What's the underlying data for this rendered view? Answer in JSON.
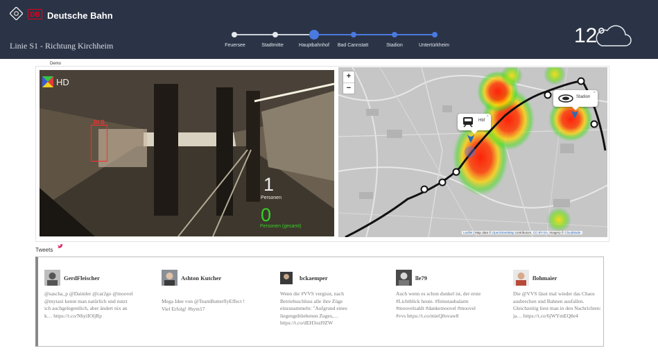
{
  "header": {
    "brand": "Deutsche Bahn",
    "db_logo_text": "DB",
    "line_title": "Linie S1 - Richtung Kirchheim",
    "stops": [
      {
        "label": "Feuersee",
        "state": "past"
      },
      {
        "label": "Stadtmitte",
        "state": "past"
      },
      {
        "label": "Hauptbahnhof",
        "state": "current"
      },
      {
        "label": "Bad Cannstatt",
        "state": "future"
      },
      {
        "label": "Stadion",
        "state": "future"
      },
      {
        "label": "Untertürkheim",
        "state": "future"
      }
    ],
    "weather": {
      "temperature": "12°",
      "icon": "cloud-icon"
    }
  },
  "demo": {
    "label": "Demo",
    "video": {
      "detection_label": "30 B",
      "count_now": "1",
      "count_now_label": "Personen",
      "count_total": "0",
      "count_total_label": "Personen (gesamt)"
    },
    "map": {
      "zoom_in": "+",
      "zoom_out": "−",
      "popups": [
        {
          "label": "Hbf",
          "icon": "train-icon"
        },
        {
          "label": "Stadion",
          "icon": "stadium-icon"
        }
      ],
      "attribution": {
        "leaflet": "Leaflet",
        "text1": " | Map data © ",
        "osm": "OpenStreetMap",
        "text2": " contributors, ",
        "license": "CC-BY-SA",
        "text3": ", Imagery © ",
        "provider": "CloudMade"
      }
    }
  },
  "tweets": {
    "title": "Tweets",
    "items": [
      {
        "name": "GerdFleischer",
        "text": "@sascha_p @Daimler @car2go @moovel @mytaxi kennt man natürlich und nutzt ich auchgelegentlich, aber ändert nix an k… https://t.co/NhyiIOljRp"
      },
      {
        "name": "Ashton Kutcher",
        "text": "Mega Idee von @TeamButterflyEffect ! Viel Erfolg! #hym17"
      },
      {
        "name": "bckaemper",
        "text": "Wenn die #VVS vergisst, nach Betriebsschluss alle ihre Züge einzusammeln: \"Aufgrund eines liegengebliebenen Zuges,… https://t.co/dEH3ozl9ZW"
      },
      {
        "name": "lle79",
        "text": "Auch wenn es schon dunkel ist, der erste #Lichtblick heute. #feinstaubalarm #moovelzahlt #dankemoovel #moovel #vvs https://t.co/mieQ0ovaw8"
      },
      {
        "name": "flohmaier",
        "text": "Die @VVS lässt mal wieder das Chaos ausbrechen und Bahnen ausfallen. Gleichzeitig liest man in den Nachrichten: ja… https://t.co/6jWYmEQ8e4"
      }
    ]
  }
}
